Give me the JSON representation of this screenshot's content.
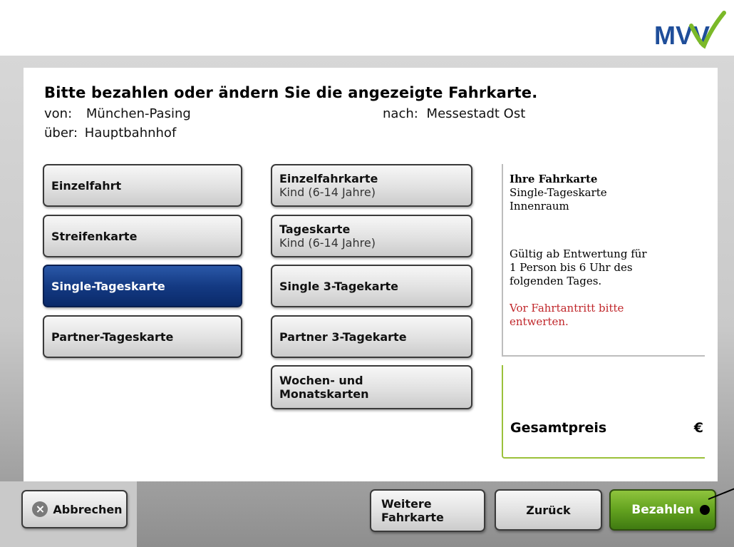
{
  "header": {
    "title": "Bitte bezahlen oder ändern Sie die angezeigte Fahrkarte.",
    "from_label": "von:",
    "from_value": "München-Pasing",
    "to_label": "nach:",
    "to_value": "Messestadt Ost",
    "via_label": "über:",
    "via_value": "Hauptbahnhof"
  },
  "logo": {
    "text": "MVV",
    "colors": {
      "blue": "#1f4e9a",
      "green": "#7bb928"
    }
  },
  "ticket_types": [
    {
      "label": "Einzelfahrt",
      "selected": false
    },
    {
      "label": "Streifenkarte",
      "selected": false
    },
    {
      "label": "Single-Tageskarte",
      "selected": true
    },
    {
      "label": "Partner-Tageskarte",
      "selected": false
    }
  ],
  "ticket_options": [
    {
      "label": "Einzelfahrkarte",
      "sub": "Kind (6-14 Jahre)"
    },
    {
      "label": "Tageskarte",
      "sub": "Kind (6-14 Jahre)"
    },
    {
      "label": "Single 3-Tagekarte",
      "sub": ""
    },
    {
      "label": "Partner 3-Tagekarte",
      "sub": ""
    },
    {
      "label": "Wochen- und",
      "sub2": "Monatskarten"
    }
  ],
  "info": {
    "heading": "Ihre Fahrkarte",
    "line1": "Single-Tageskarte",
    "line2": "Innenraum",
    "validity1": "Gültig ab Entwertung für",
    "validity2": "1 Person bis 6 Uhr des",
    "validity3": "folgenden Tages.",
    "warning1": "Vor Fahrtantritt bitte",
    "warning2": "entwerten."
  },
  "price": {
    "label": "Gesamtpreis",
    "currency": "€"
  },
  "actions": {
    "abort": "Abbrechen",
    "abort_icon": "×",
    "more_line1": "Weitere",
    "more_line2": "Fahrkarte",
    "back": "Zurück",
    "pay": "Bezahlen"
  }
}
